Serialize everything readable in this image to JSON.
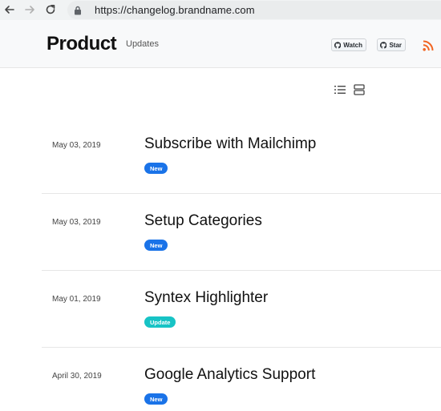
{
  "browser": {
    "url": "https://changelog.brandname.com",
    "back_icon": "arrow-left-icon",
    "forward_icon": "arrow-right-icon",
    "reload_icon": "reload-icon",
    "lock_icon": "lock-icon"
  },
  "header": {
    "brand": "Product",
    "nav_updates": "Updates",
    "watch_label": "Watch",
    "star_label": "Star",
    "rss_icon": "rss-icon",
    "rss_color": "#f26522"
  },
  "view_toggles": {
    "list_icon": "list-view-icon",
    "card_icon": "card-view-icon"
  },
  "entries": [
    {
      "date": "May 03, 2019",
      "title": "Subscribe with Mailchimp",
      "badge": "New",
      "badge_color": "#1a73e8"
    },
    {
      "date": "May 03, 2019",
      "title": "Setup Categories",
      "badge": "New",
      "badge_color": "#1a73e8"
    },
    {
      "date": "May 01, 2019",
      "title": "Syntex Highlighter",
      "badge": "Update",
      "badge_color": "#17c3c5"
    },
    {
      "date": "April 30, 2019",
      "title": "Google Analytics Support",
      "badge": "New",
      "badge_color": "#1a73e8"
    }
  ]
}
